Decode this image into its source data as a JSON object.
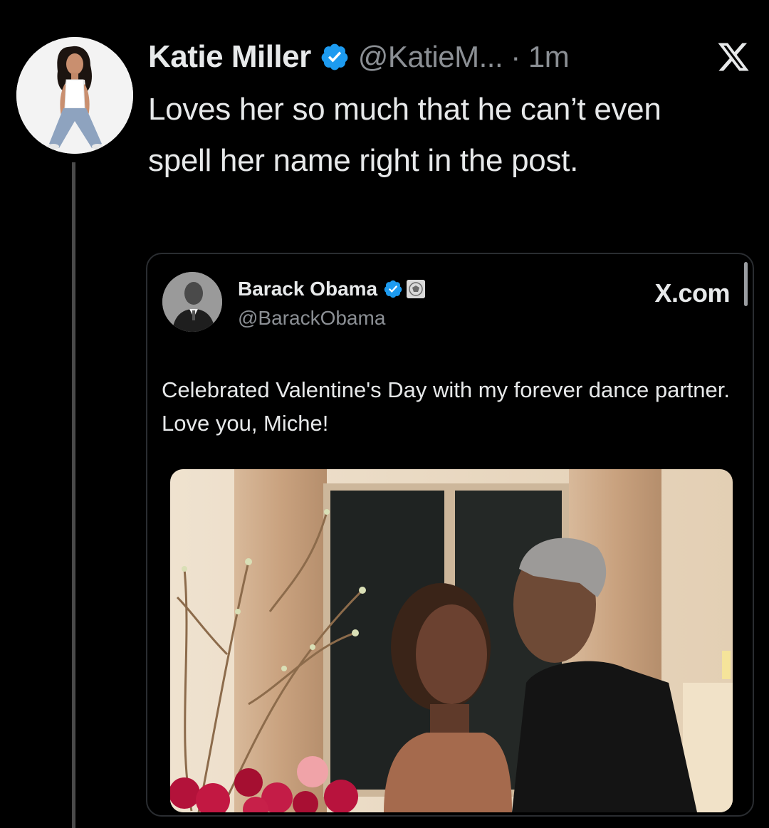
{
  "tweet": {
    "display_name": "Katie Miller",
    "handle_time": "@KatieM... · 1m",
    "text": "Loves her so much that he can’t even spell her name right in the post.",
    "colors": {
      "verified": "#1d9bf0",
      "background": "#000000",
      "text": "#e7e9ea",
      "muted": "#8b8f94"
    }
  },
  "quoted": {
    "display_name": "Barack Obama",
    "handle": "@BarackObama",
    "site": "X.com",
    "text": "Celebrated Valentine's Day with my forever dance partner. Love you, Miche!"
  },
  "icons": {
    "brand": "x-logo-icon",
    "verified": "verified-badge-icon",
    "affiliation": "government-seal-icon"
  }
}
